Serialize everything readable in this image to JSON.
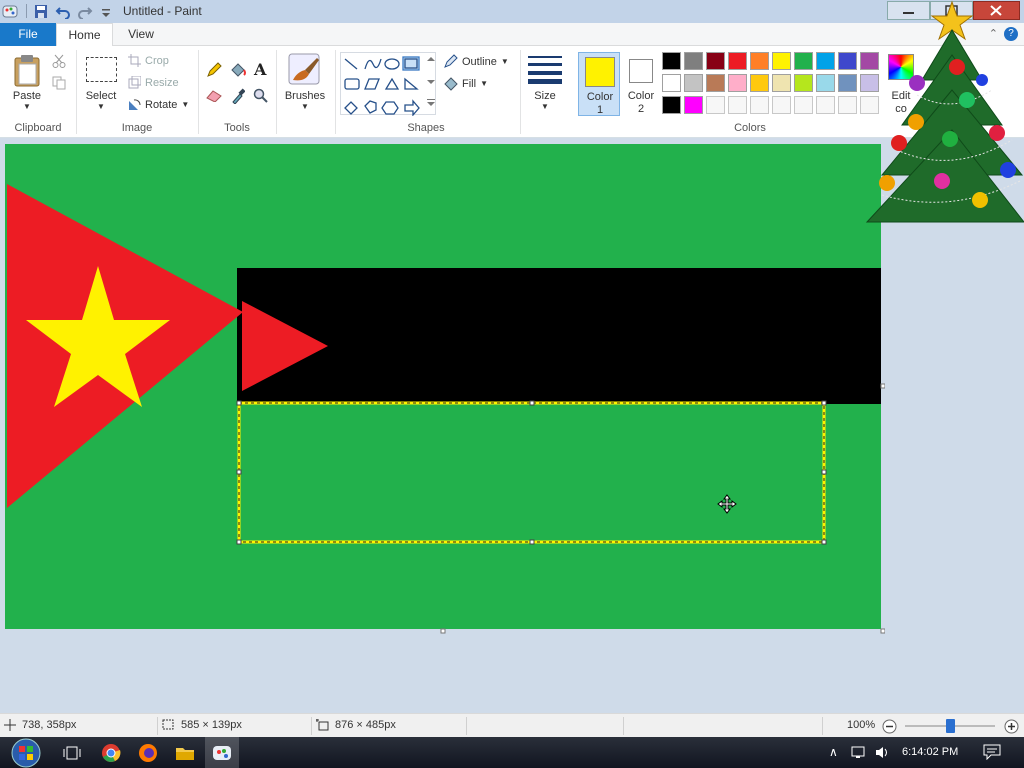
{
  "window": {
    "title": "Untitled - Paint"
  },
  "tabs": {
    "file": "File",
    "home": "Home",
    "view": "View"
  },
  "clipboard": {
    "paste": "Paste",
    "group": "Clipboard"
  },
  "image": {
    "select": "Select",
    "crop": "Crop",
    "resize": "Resize",
    "rotate": "Rotate",
    "group": "Image"
  },
  "tools": {
    "group": "Tools"
  },
  "brushes": {
    "label": "Brushes"
  },
  "shapes": {
    "outline": "Outline",
    "fill": "Fill",
    "group": "Shapes"
  },
  "size": {
    "label": "Size"
  },
  "colors": {
    "color1_line1": "Color",
    "color1_line2": "1",
    "color2_line1": "Color",
    "color2_line2": "2",
    "edit_line1": "Edit",
    "edit_line2": "co",
    "group": "Colors",
    "color1_value": "#FFF200",
    "color2_value": "#FFFFFF",
    "palette": [
      "#000000",
      "#7F7F7F",
      "#880015",
      "#ED1C24",
      "#FF7F27",
      "#FFF200",
      "#22B14C",
      "#00A2E8",
      "#3F48CC",
      "#A349A4",
      "#FFFFFF",
      "#C3C3C3",
      "#B97A57",
      "#FFAEC9",
      "#FFC90E",
      "#EFE4B0",
      "#B5E61D",
      "#99D9EA",
      "#7092BE",
      "#C8BFE7",
      "#000000",
      "#FF00FF",
      "#F0F0F0",
      "#F0F0F0",
      "#F0F0F0",
      "#F0F0F0",
      "#F0F0F0",
      "#F0F0F0",
      "#F0F0F0",
      "#F0F0F0"
    ]
  },
  "status": {
    "cursor": "738, 358px",
    "selection": "585 × 139px",
    "canvas": "876 × 485px",
    "zoom": "100%"
  },
  "taskbar": {
    "time": "6:14:02 PM"
  },
  "canvas": {
    "background": "#22B14C",
    "stripe": "#000000",
    "triangle": "#ED1C24",
    "star": "#FFF200",
    "selection_outline": "#FFF200"
  }
}
